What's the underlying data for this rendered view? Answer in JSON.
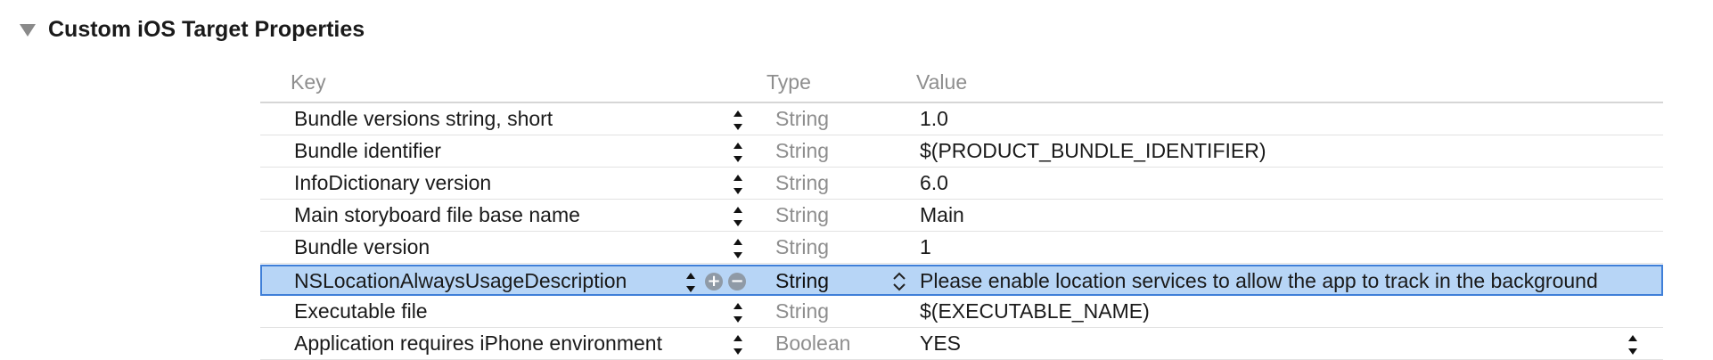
{
  "section": {
    "title": "Custom iOS Target Properties"
  },
  "table": {
    "headers": {
      "key": "Key",
      "type": "Type",
      "value": "Value"
    },
    "rows": [
      {
        "key": "Bundle versions string, short",
        "type": "String",
        "value": "1.0"
      },
      {
        "key": "Bundle identifier",
        "type": "String",
        "value": "$(PRODUCT_BUNDLE_IDENTIFIER)"
      },
      {
        "key": "InfoDictionary version",
        "type": "String",
        "value": "6.0"
      },
      {
        "key": "Main storyboard file base name",
        "type": "String",
        "value": "Main"
      },
      {
        "key": "Bundle version",
        "type": "String",
        "value": "1"
      },
      {
        "key": "NSLocationAlwaysUsageDescription",
        "type": "String",
        "value": "Please enable location services to allow the app to track in the background",
        "selected": true
      },
      {
        "key": "Executable file",
        "type": "String",
        "value": "$(EXECUTABLE_NAME)"
      },
      {
        "key": "Application requires iPhone environment",
        "type": "Boolean",
        "value": "YES"
      }
    ]
  },
  "icons": {
    "disclosure": "disclosure-triangle-icon",
    "stepper": "up-down-stepper-icon",
    "add": "add-row-icon",
    "remove": "remove-row-icon",
    "type_popup": "chevron-updown-icon"
  },
  "colors": {
    "selection_fill": "#b7d5f6",
    "selection_border": "#3f7fd8",
    "muted_text": "#8e8e8e"
  }
}
